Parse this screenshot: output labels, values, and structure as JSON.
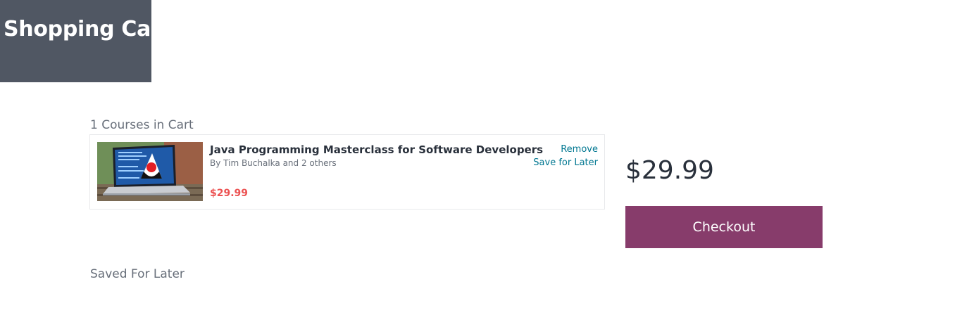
{
  "header": {
    "title": "Shopping Cart"
  },
  "cart": {
    "count_label": "1 Courses in Cart",
    "items": [
      {
        "title": "Java Programming Masterclass for Software Developers",
        "author": "By Tim Buchalka and 2 others",
        "price": "$29.99",
        "remove_label": "Remove",
        "save_label": "Save for Later",
        "thumbnail_icon": "laptop-java-duke-thumbnail"
      }
    ]
  },
  "summary": {
    "total": "$29.99",
    "checkout_label": "Checkout"
  },
  "saved": {
    "heading": "Saved For Later"
  },
  "colors": {
    "header_bg": "#505763",
    "price_red": "#ec5252",
    "link_teal": "#007791",
    "checkout_bg": "#873c6b"
  }
}
